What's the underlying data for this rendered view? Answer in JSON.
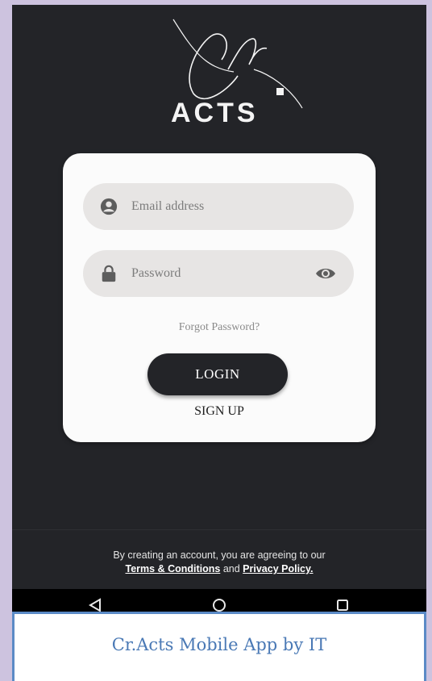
{
  "logo": {
    "script": "Cr.",
    "wordmark": "ACTS"
  },
  "login_form": {
    "email_placeholder": "Email address",
    "password_placeholder": "Password",
    "forgot_label": "Forgot Password?",
    "login_label": "LOGIN",
    "signup_label": "SIGN UP"
  },
  "footer": {
    "terms_prefix": "By creating an account, you are agreeing to our",
    "terms_link": "Terms & Conditions",
    "and_text": "and",
    "privacy_link": "Privacy Policy."
  },
  "navbar": {
    "icons": [
      "back-triangle-icon",
      "home-circle-icon",
      "recents-square-icon"
    ]
  },
  "caption": {
    "text": "Cr.Acts Mobile App by IT"
  },
  "colors": {
    "background": "#cdc3df",
    "phone": "#232428",
    "card": "#fbfbfb",
    "field": "#e7e5e4",
    "caption_border": "#5b8ac6",
    "caption_text": "#4a79b5"
  }
}
